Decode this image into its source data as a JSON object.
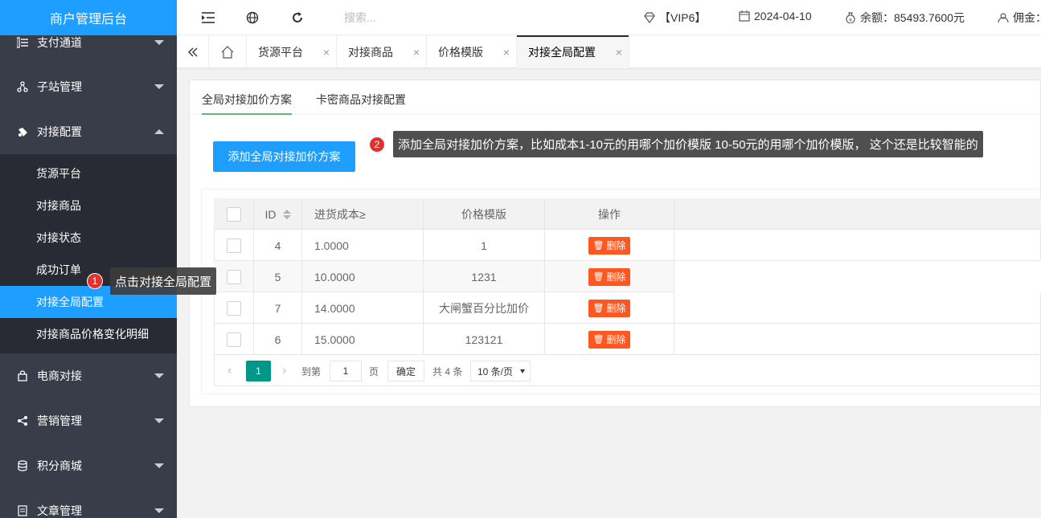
{
  "sidebar": {
    "logo": "商户管理后台",
    "groups": [
      {
        "label": "支付通道",
        "icon": "list-icon"
      },
      {
        "label": "子站管理",
        "icon": "sitemap-icon"
      },
      {
        "label": "对接配置",
        "icon": "plug-icon"
      },
      {
        "label": "电商对接",
        "icon": "bag-icon"
      },
      {
        "label": "营销管理",
        "icon": "share-icon"
      },
      {
        "label": "积分商城",
        "icon": "coins-icon"
      },
      {
        "label": "文章管理",
        "icon": "doc-icon"
      }
    ],
    "sub_items": [
      {
        "label": "货源平台"
      },
      {
        "label": "对接商品"
      },
      {
        "label": "对接状态"
      },
      {
        "label": "成功订单"
      },
      {
        "label": "对接全局配置"
      },
      {
        "label": "对接商品价格变化明细"
      }
    ]
  },
  "header": {
    "search_placeholder": "搜索...",
    "vip": "【VIP6】",
    "date": "2024-04-10",
    "balance": "余额：85493.7600元",
    "commission": "佣金："
  },
  "tabs": [
    {
      "label": "货源平台",
      "close": "×"
    },
    {
      "label": "对接商品",
      "close": "×"
    },
    {
      "label": "价格模版",
      "close": "×"
    },
    {
      "label": "对接全局配置",
      "close": "×"
    }
  ],
  "sub_tabs": [
    {
      "label": "全局对接加价方案"
    },
    {
      "label": "卡密商品对接配置"
    }
  ],
  "add_button": "添加全局对接加价方案",
  "table": {
    "headers": {
      "id": "ID",
      "cost": "进货成本≥",
      "template": "价格模版",
      "action": "操作"
    },
    "delete_label": "删除",
    "rows": [
      {
        "id": "4",
        "cost": "1.0000",
        "template": "1"
      },
      {
        "id": "5",
        "cost": "10.0000",
        "template": "1231"
      },
      {
        "id": "7",
        "cost": "14.0000",
        "template": "大闸蟹百分比加价"
      },
      {
        "id": "6",
        "cost": "15.0000",
        "template": "123121"
      }
    ]
  },
  "pager": {
    "current": "1",
    "goto_label": "到第",
    "goto_value": "1",
    "page_unit": "页",
    "ok": "确定",
    "total": "共 4 条",
    "per_page": "10 条/页"
  },
  "annotations": [
    {
      "num": "1",
      "text": "点击对接全局配置"
    },
    {
      "num": "2",
      "text": "添加全局对接加价方案，比如成本1-10元的用哪个加价模版  10-50元的用哪个加价模版， 这个还是比较智能的"
    }
  ]
}
